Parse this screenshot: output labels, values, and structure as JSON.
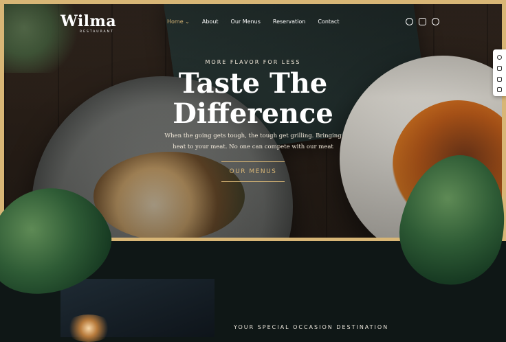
{
  "brand": {
    "name": "Wilma",
    "tagline": "RESTAURANT"
  },
  "nav": {
    "items": [
      "Home",
      "About",
      "Our Menus",
      "Reservation",
      "Contact"
    ],
    "active": "Home"
  },
  "social": [
    "facebook-icon",
    "instagram-icon",
    "tripadvisor-icon"
  ],
  "hero": {
    "eyebrow": "MORE FLAVOR FOR LESS",
    "title_line1": "Taste The",
    "title_line2": "Difference",
    "description": "When the going gets tough, the tough get grilling. Bringing heat to your meat. No one can compete with our meat",
    "cta": "OUR MENUS"
  },
  "side_toolbar": [
    "settings-icon",
    "heart-icon",
    "book-icon",
    "cart-icon"
  ],
  "section2": {
    "eyebrow": "YOUR SPECIAL OCCASION DESTINATION"
  },
  "colors": {
    "accent": "#d8b676",
    "background": "#0f1716"
  }
}
